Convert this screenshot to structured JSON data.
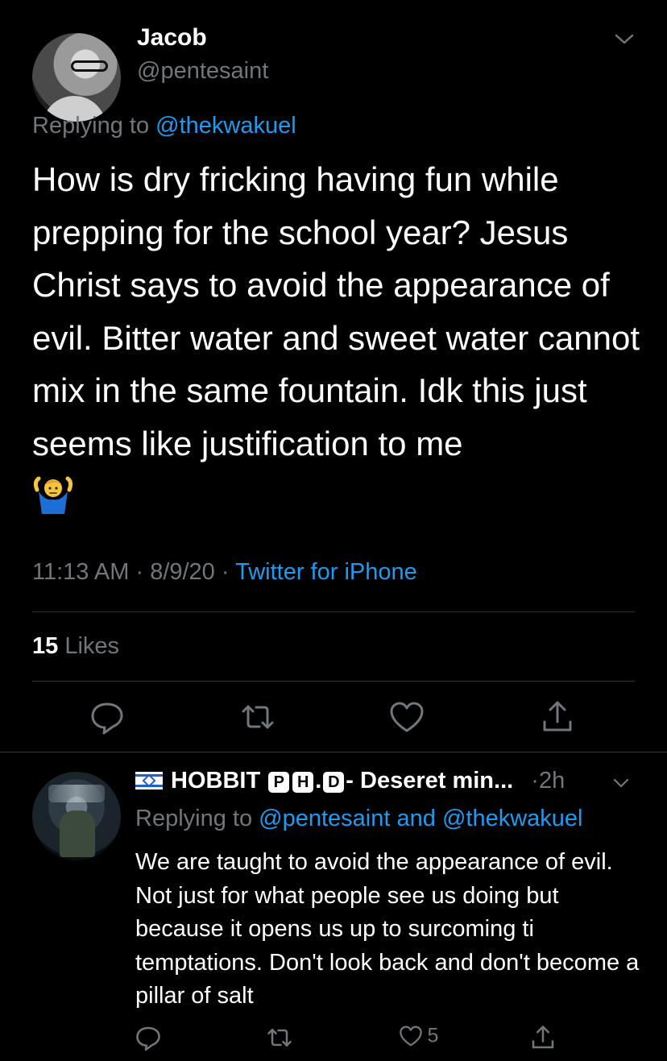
{
  "tweet": {
    "author_name": "Jacob",
    "author_handle": "@pentesaint",
    "replying_prefix": "Replying to",
    "replying_handle": "@thekwakuel",
    "text": "How is dry fricking having fun while prepping for the school year? Jesus Christ says to avoid the appearance of evil. Bitter water and sweet water cannot mix in the same fountain. Idk this just seems like justification to me",
    "emoji": "person-shrugging",
    "time": "11:13 AM",
    "date": "8/9/20",
    "separator": "·",
    "source": "Twitter for iPhone",
    "likes_count": "15",
    "likes_label": "Likes"
  },
  "reply": {
    "name_prefix": "HOBBIT",
    "name_box_1": "P",
    "name_box_2": "H",
    "name_dot": ".",
    "name_box_3": "D",
    "name_suffix": "- Deseret min...",
    "age": "2h",
    "age_separator": "·",
    "replying_prefix": "Replying to",
    "replying_handle_1": "@pentesaint",
    "replying_and": "and",
    "replying_handle_2": "@thekwakuel",
    "text": "We are taught to avoid the appearance of evil. Not just for what people see us doing but because it opens us up to surcoming ti temptations. Don't look back and don't become a pillar of salt",
    "like_count": "5"
  },
  "icons": {
    "reply": "comment-icon",
    "retweet": "retweet-icon",
    "like": "heart-icon",
    "share": "share-icon",
    "more": "chevron-down-icon",
    "flag": "israel-flag-icon"
  },
  "colors": {
    "background": "#000000",
    "text": "#e7e9ea",
    "muted": "#71767b",
    "link": "#1d9bf0",
    "divider": "#2f3336"
  }
}
